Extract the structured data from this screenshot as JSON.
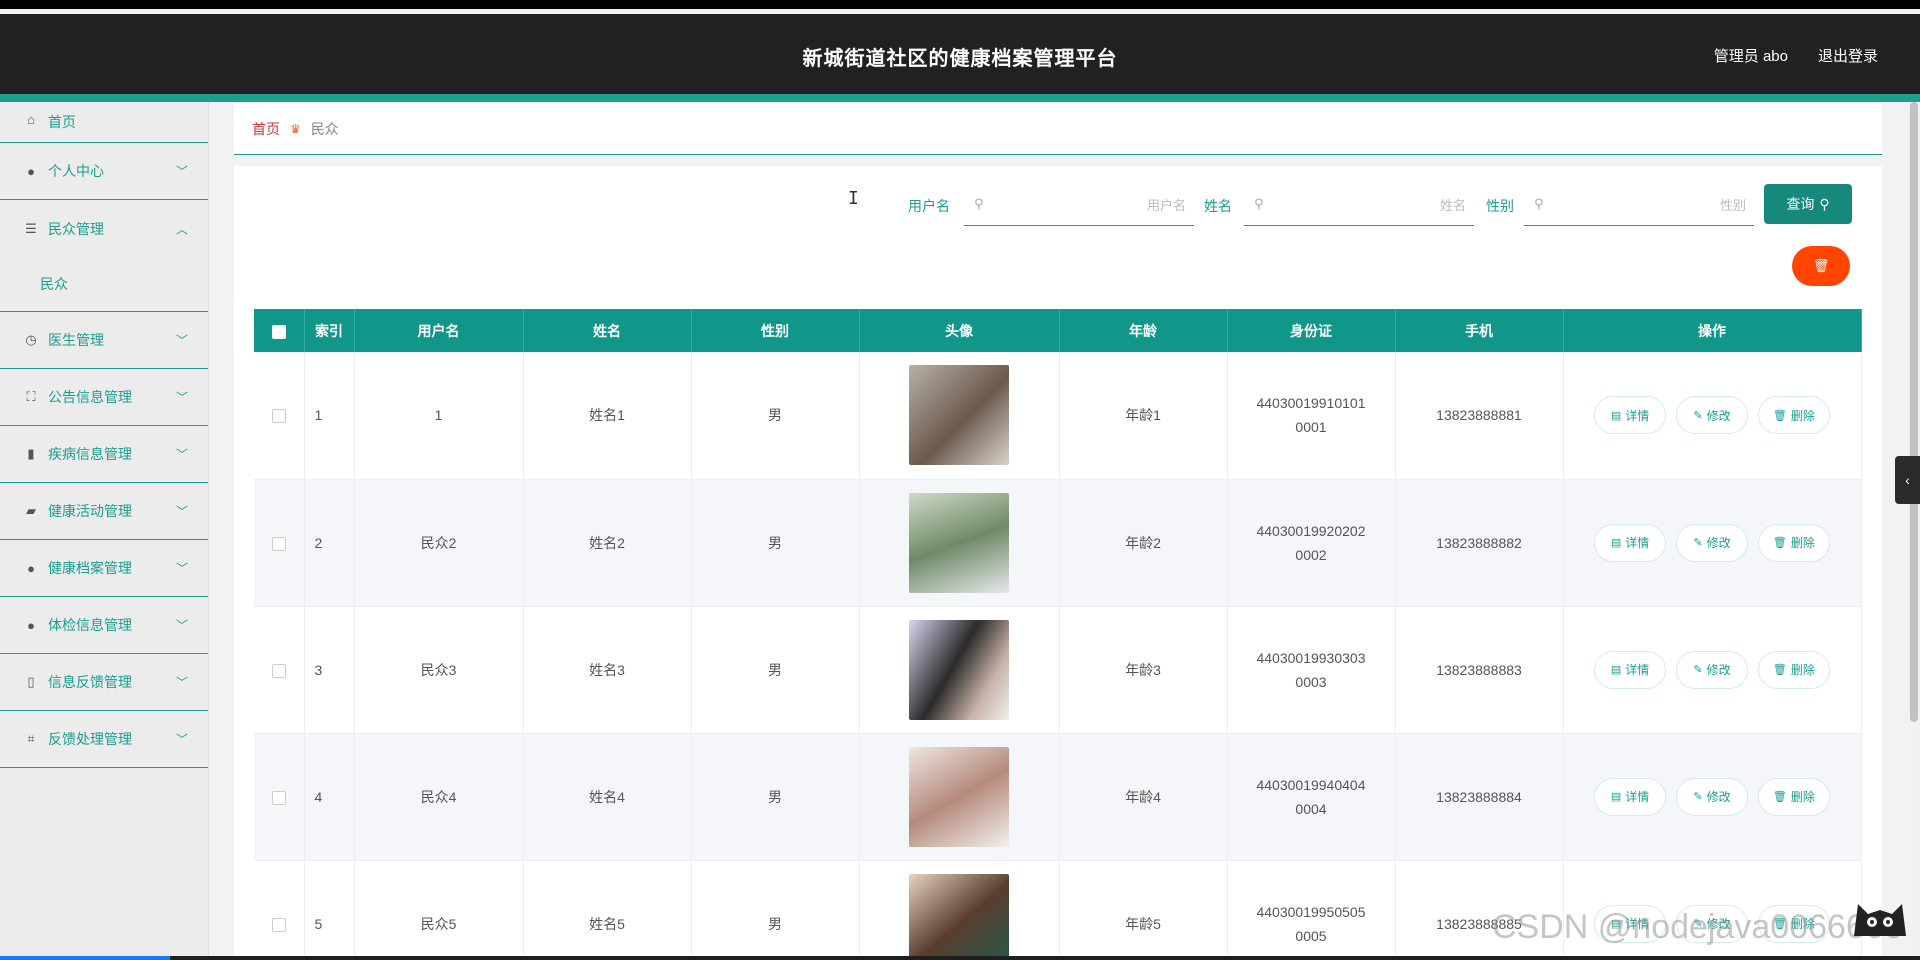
{
  "header": {
    "title": "新城街道社区的健康档案管理平台",
    "admin": "管理员 abo",
    "logout": "退出登录"
  },
  "sidebar": {
    "items": [
      {
        "label": "首页",
        "icon": "home-icon"
      },
      {
        "label": "个人中心",
        "icon": "user-icon"
      },
      {
        "label": "民众管理",
        "icon": "sliders-icon",
        "expanded": true,
        "sub": "民众"
      },
      {
        "label": "医生管理",
        "icon": "clock-icon"
      },
      {
        "label": "公告信息管理",
        "icon": "scan-icon"
      },
      {
        "label": "疾病信息管理",
        "icon": "chart-icon"
      },
      {
        "label": "健康活动管理",
        "icon": "thumb-icon"
      },
      {
        "label": "健康档案管理",
        "icon": "user-icon"
      },
      {
        "label": "体检信息管理",
        "icon": "user-icon"
      },
      {
        "label": "信息反馈管理",
        "icon": "phone-icon"
      },
      {
        "label": "反馈处理管理",
        "icon": "crop-icon"
      }
    ]
  },
  "breadcrumb": {
    "home": "首页",
    "current": "民众"
  },
  "search": {
    "username_label": "用户名",
    "username_placeholder": "用户名",
    "name_label": "姓名",
    "name_placeholder": "姓名",
    "gender_label": "性别",
    "gender_placeholder": "性别",
    "query_label": "查询"
  },
  "table": {
    "headers": [
      "索引",
      "用户名",
      "姓名",
      "性别",
      "头像",
      "年龄",
      "身份证",
      "手机",
      "操作"
    ],
    "actions": {
      "detail": "详情",
      "edit": "修改",
      "delete": "删除"
    },
    "rows": [
      {
        "index": "1",
        "username": "1",
        "name": "姓名1",
        "gender": "男",
        "age": "年龄1",
        "id": "440300199101010001",
        "phone": "13823888881"
      },
      {
        "index": "2",
        "username": "民众2",
        "name": "姓名2",
        "gender": "男",
        "age": "年龄2",
        "id": "440300199202020002",
        "phone": "13823888882"
      },
      {
        "index": "3",
        "username": "民众3",
        "name": "姓名3",
        "gender": "男",
        "age": "年龄3",
        "id": "440300199303030003",
        "phone": "13823888883"
      },
      {
        "index": "4",
        "username": "民众4",
        "name": "姓名4",
        "gender": "男",
        "age": "年龄4",
        "id": "440300199404040004",
        "phone": "13823888884"
      },
      {
        "index": "5",
        "username": "民众5",
        "name": "姓名5",
        "gender": "男",
        "age": "年龄5",
        "id": "440300199505050005",
        "phone": "13823888885"
      }
    ]
  },
  "watermark": "CSDN @nodejava0066666",
  "colors": {
    "accent": "#1a9e8f",
    "header": "#212121",
    "danger": "#ff4500",
    "breadcrumb_home": "#c8383d"
  }
}
